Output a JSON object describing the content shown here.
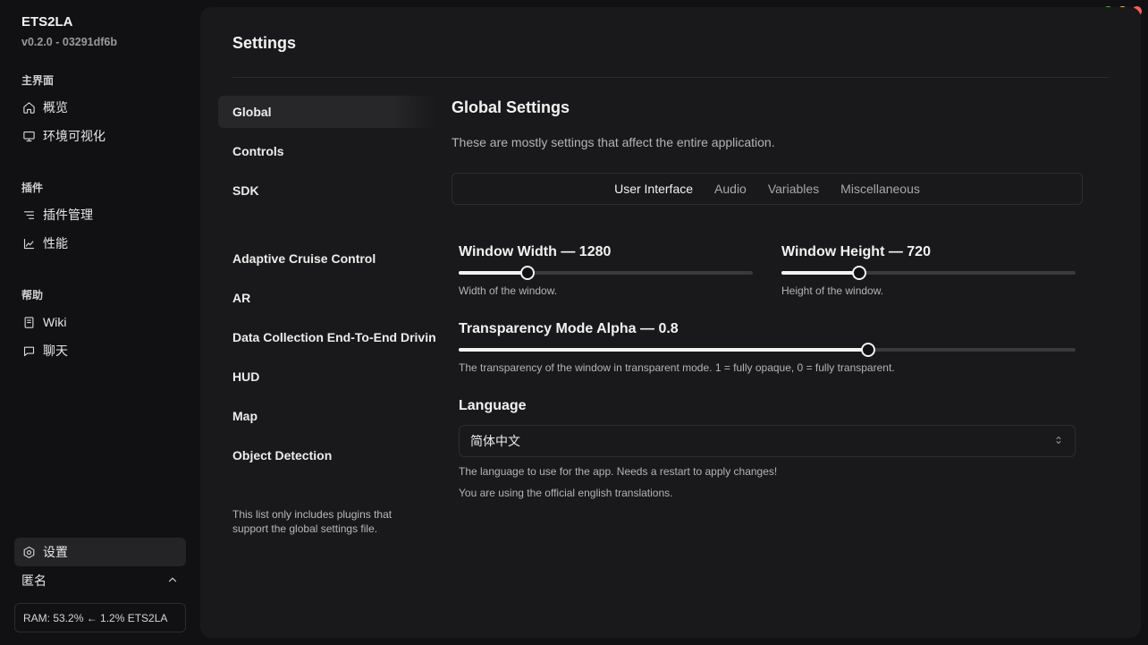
{
  "app": {
    "name": "ETS2LA",
    "version": "v0.2.0 - 03291df6b"
  },
  "window_controls": {
    "colors": [
      "#27c93f",
      "#ffbd2e",
      "#ff5f56"
    ]
  },
  "sidebar": {
    "groups": [
      {
        "label": "主界面",
        "items": [
          {
            "label": "概览",
            "icon": "home-icon"
          },
          {
            "label": "环境可视化",
            "icon": "monitor-icon"
          }
        ]
      },
      {
        "label": "插件",
        "items": [
          {
            "label": "插件管理",
            "icon": "list-icon"
          },
          {
            "label": "性能",
            "icon": "chart-icon"
          }
        ]
      },
      {
        "label": "帮助",
        "items": [
          {
            "label": "Wiki",
            "icon": "book-icon"
          },
          {
            "label": "聊天",
            "icon": "chat-icon"
          }
        ]
      }
    ],
    "settings_label": "设置",
    "user_label": "匿名",
    "status": "RAM: 53.2% ← 1.2% ETS2LA"
  },
  "page": {
    "title": "Settings"
  },
  "categories": {
    "items": [
      "Global",
      "Controls",
      "SDK",
      "Adaptive Cruise Control",
      "AR",
      "Data Collection End-To-End Driving",
      "HUD",
      "Map",
      "Object Detection"
    ],
    "active": "Global",
    "note": "This list only includes plugins that support the global settings file."
  },
  "section": {
    "title": "Global Settings",
    "description": "These are mostly settings that affect the entire application.",
    "tabs": [
      "User Interface",
      "Audio",
      "Variables",
      "Miscellaneous"
    ],
    "active_tab": "User Interface"
  },
  "fields": {
    "window_width": {
      "label": "Window Width — 1280",
      "help": "Width of the window.",
      "level": 0.235
    },
    "window_height": {
      "label": "Window Height — 720",
      "help": "Height of the window.",
      "level": 0.265
    },
    "transparency": {
      "label": "Transparency Mode Alpha — 0.8",
      "help": "The transparency of the window in transparent mode. 1 = fully opaque, 0 = fully transparent.",
      "level": 0.664
    },
    "language": {
      "label": "Language",
      "value": "简体中文",
      "help": "The language to use for the app. Needs a restart to apply changes!",
      "note": "You are using the official english translations."
    }
  }
}
